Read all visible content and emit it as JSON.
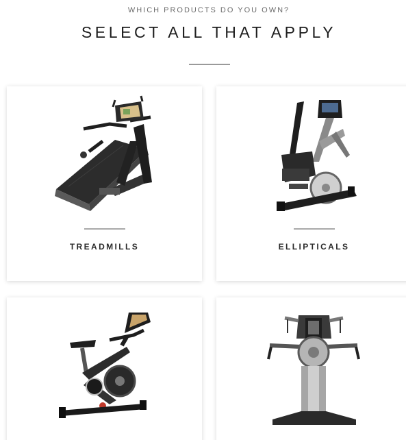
{
  "header": {
    "eyebrow": "WHICH PRODUCTS DO YOU OWN?",
    "title": "SELECT ALL THAT APPLY"
  },
  "products": [
    {
      "label": "TREADMILLS",
      "icon": "treadmill-icon"
    },
    {
      "label": "ELLIPTICALS",
      "icon": "elliptical-icon"
    },
    {
      "label": "",
      "icon": "exercise-bike-icon"
    },
    {
      "label": "",
      "icon": "home-gym-icon"
    }
  ]
}
